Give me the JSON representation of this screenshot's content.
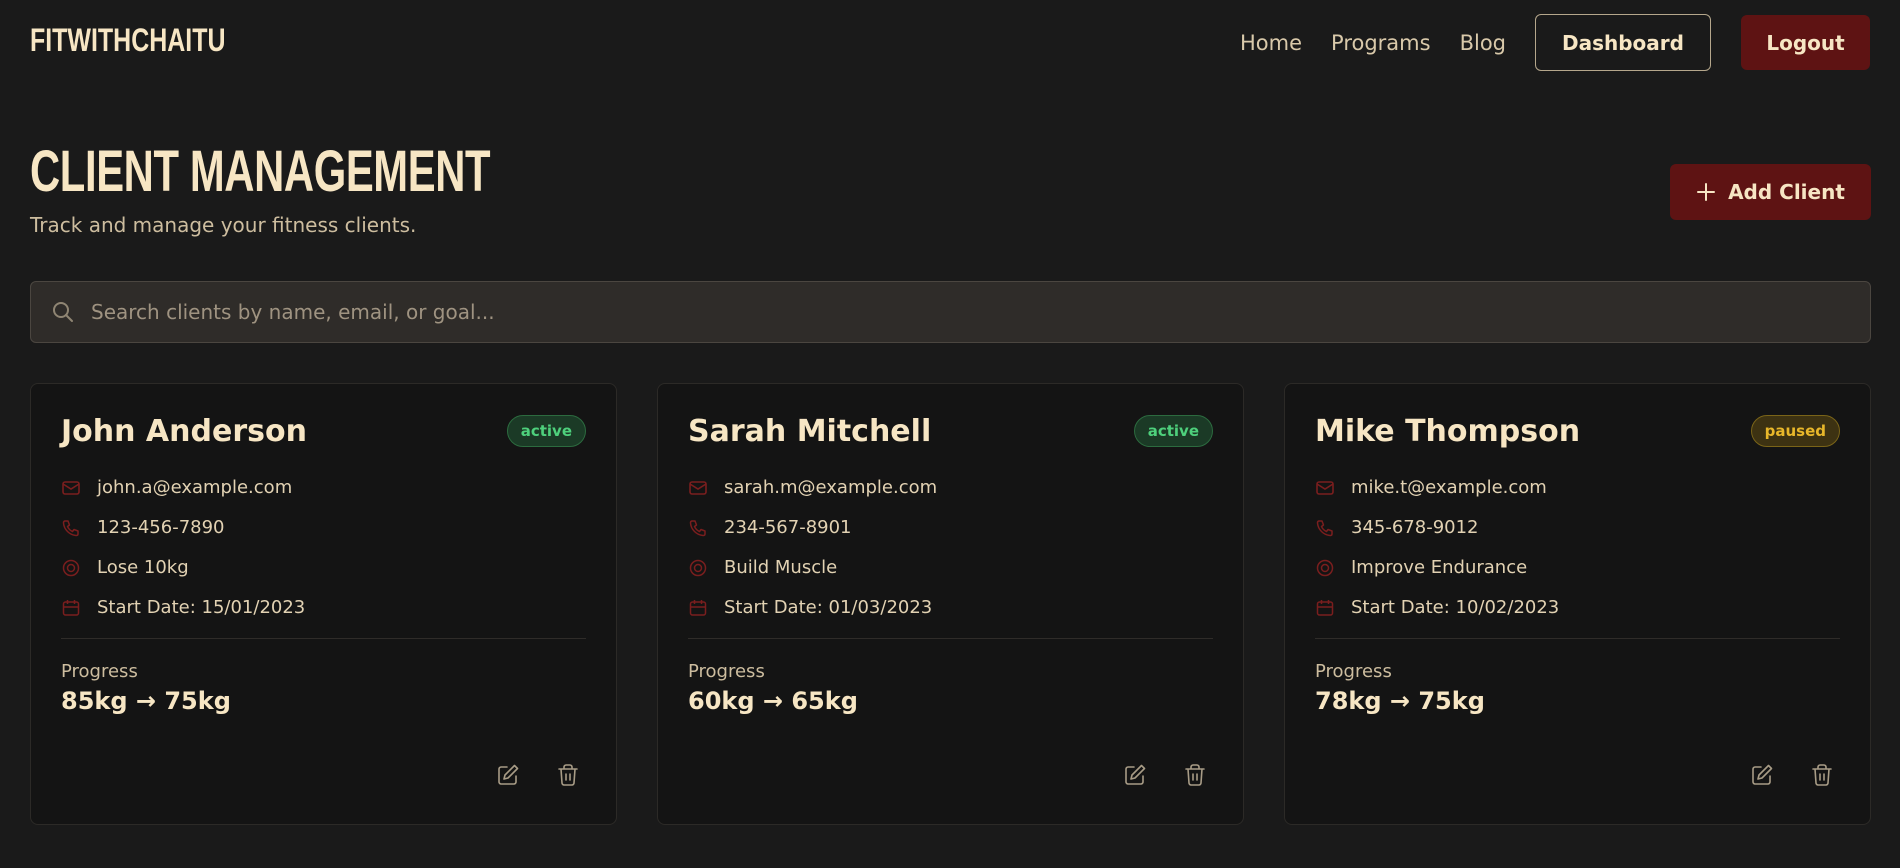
{
  "nav": {
    "logo": "FITWITHCHAITU",
    "links": [
      "Home",
      "Programs",
      "Blog"
    ],
    "dashboard_label": "Dashboard",
    "logout_label": "Logout"
  },
  "header": {
    "title": "CLIENT MANAGEMENT",
    "subtitle": "Track and manage your fitness clients.",
    "add_label": "Add Client"
  },
  "search": {
    "placeholder": "Search clients by name, email, or goal..."
  },
  "colors": {
    "accent": "#5e1313",
    "icon_red": "#7a1e1e",
    "active": "#4ed07c",
    "paused": "#e8b72a"
  },
  "clients": [
    {
      "name": "John Anderson",
      "status": "active",
      "email": "john.a@example.com",
      "phone": "123-456-7890",
      "goal": "Lose 10kg",
      "start": "Start Date: 15/01/2023",
      "progress_label": "Progress",
      "progress": "85kg → 75kg"
    },
    {
      "name": "Sarah Mitchell",
      "status": "active",
      "email": "sarah.m@example.com",
      "phone": "234-567-8901",
      "goal": "Build Muscle",
      "start": "Start Date: 01/03/2023",
      "progress_label": "Progress",
      "progress": "60kg → 65kg"
    },
    {
      "name": "Mike Thompson",
      "status": "paused",
      "email": "mike.t@example.com",
      "phone": "345-678-9012",
      "goal": "Improve Endurance",
      "start": "Start Date: 10/02/2023",
      "progress_label": "Progress",
      "progress": "78kg → 75kg"
    }
  ]
}
